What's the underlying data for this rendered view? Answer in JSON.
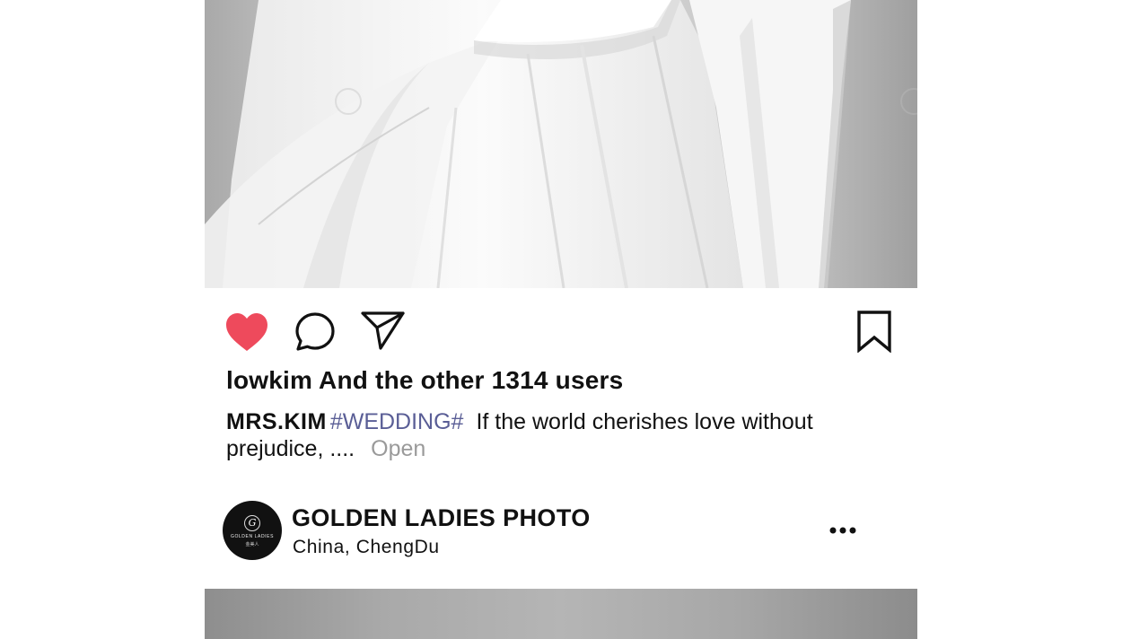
{
  "post": {
    "likes_text": "lowkim And the other 1314 users",
    "caption": {
      "username": "MRS.KIM",
      "hashtag": "#WEDDING#",
      "text": "If the world cherishes love without prejudice, ....",
      "open_label": "Open"
    },
    "icons": {
      "like": "heart-icon",
      "comment": "comment-bubble-icon",
      "share": "paper-plane-icon",
      "save": "bookmark-icon",
      "more": "ellipsis-icon"
    },
    "liked": true
  },
  "next_post": {
    "account_name": "GOLDEN LADIES PHOTO",
    "location": "China,  ChengDu",
    "avatar": {
      "logo_letter": "G",
      "logo_text": "GOLDEN LADIES",
      "logo_sub": "金美人"
    }
  },
  "colors": {
    "heart": "#ee4a5c",
    "hashtag": "#5a5e96",
    "open_link": "#9a9a9a",
    "text": "#111111"
  }
}
